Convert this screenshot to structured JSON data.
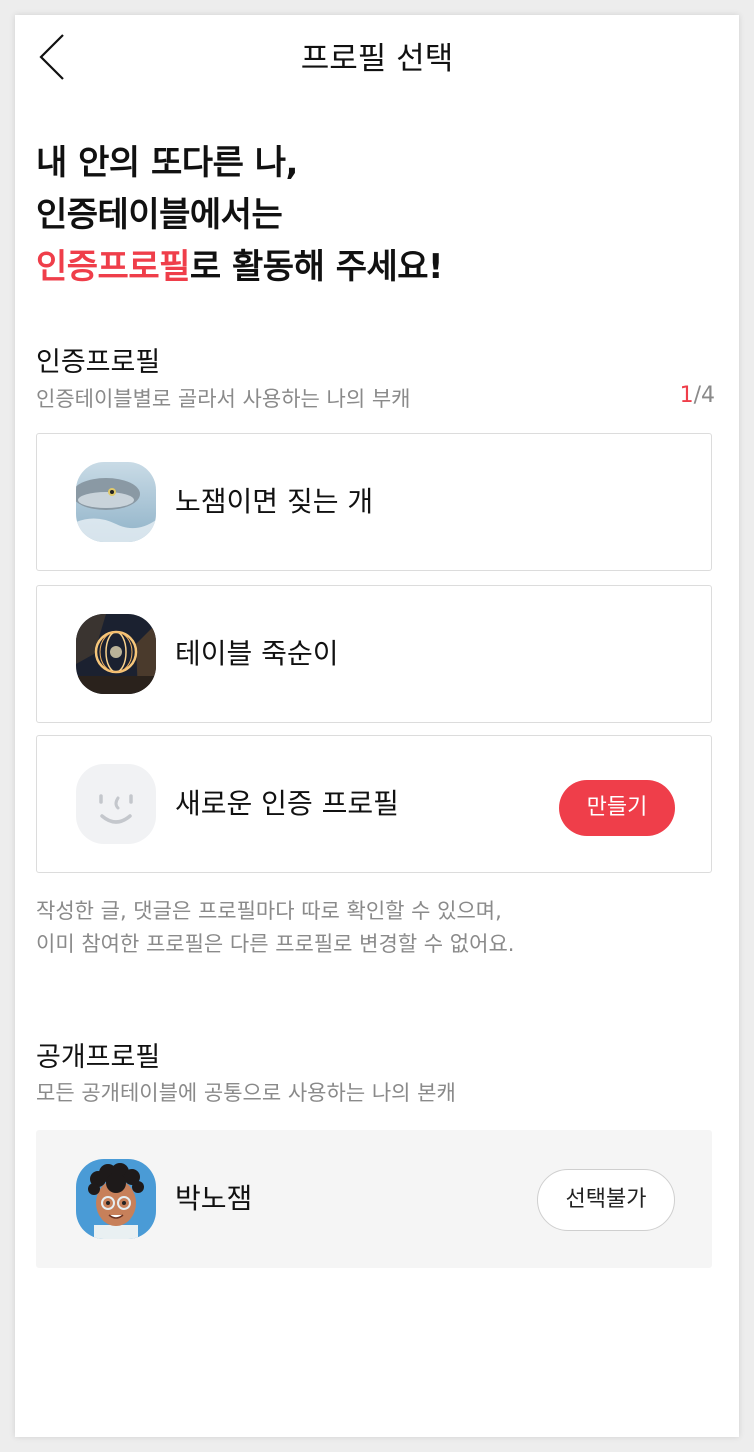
{
  "header": {
    "title": "프로필 선택"
  },
  "headline": {
    "line1": "내 안의 또다른 나,",
    "line2": "인증테이블에서는",
    "line3_accent": "인증프로필",
    "line3_rest": "로 활동해 주세요!"
  },
  "auth_section": {
    "title": "인증프로필",
    "subtitle": "인증테이블별로 골라서 사용하는 나의 부캐",
    "count_current": "1",
    "count_total": "/4",
    "profiles": [
      {
        "name": "노잼이면 짖는 개",
        "avatar": "fish-photo"
      },
      {
        "name": "테이블 죽순이",
        "avatar": "light-orb-photo"
      }
    ],
    "new_profile": {
      "name": "새로운 인증 프로필",
      "avatar": "smiley-face-icon",
      "button_label": "만들기"
    },
    "notice_line1": "작성한 글, 댓글은 프로필마다 따로 확인할 수 있으며,",
    "notice_line2": "이미 참여한 프로필은 다른 프로필로 변경할 수 없어요."
  },
  "public_section": {
    "title": "공개프로필",
    "subtitle": "모든 공개테이블에 공통으로 사용하는 나의 본캐",
    "profile": {
      "name": "박노잼",
      "avatar": "cartoon-person",
      "button_label": "선택불가"
    }
  },
  "colors": {
    "accent": "#ef3e4a",
    "muted": "#8a8a8a",
    "card_border": "#dcdcdc"
  }
}
